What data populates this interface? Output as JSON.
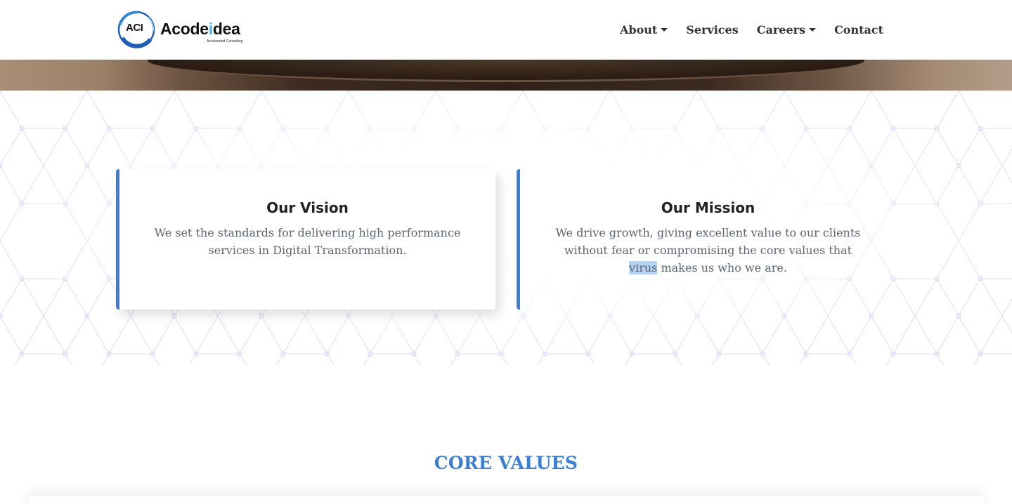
{
  "navbar": {
    "logo": {
      "mark_text": "ACI",
      "name_part1": "Acode",
      "name_highlight": "i",
      "name_part2": "dea",
      "tagline": "Accelerated Consulting"
    },
    "items": [
      {
        "label": "About",
        "has_dropdown": true
      },
      {
        "label": "Services",
        "has_dropdown": false
      },
      {
        "label": "Careers",
        "has_dropdown": true
      },
      {
        "label": "Contact",
        "has_dropdown": false
      }
    ]
  },
  "vision": {
    "title": "Our Vision",
    "text": "We set the standards for delivering high performance services in Digital Transformation."
  },
  "mission": {
    "title": "Our Mission",
    "text_before": "We drive growth, giving excellent value to our clients without fear or compromising the core values that ",
    "text_selected": "virus",
    "text_after": " makes us who we are."
  },
  "core_values": {
    "title": "CORE VALUES"
  },
  "colors": {
    "accent": "#3a7fd5",
    "logo_highlight": "#4ab4e6",
    "text_muted": "#5d6470",
    "selection": "#b5d4f4"
  }
}
